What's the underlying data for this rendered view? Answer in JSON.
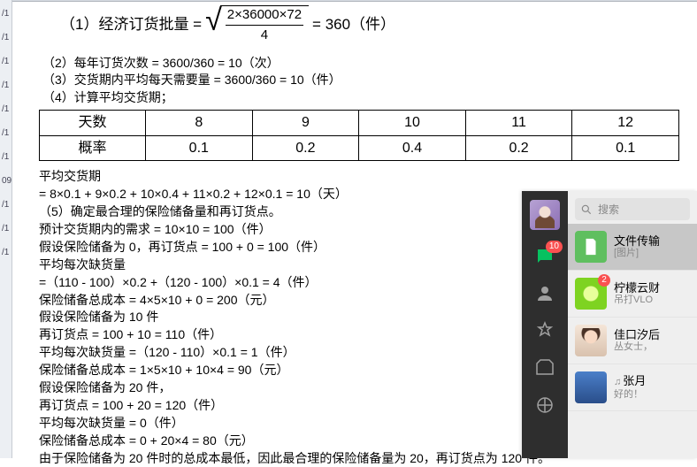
{
  "doc": {
    "f1_label": "（1）经济订货批量 =",
    "f1_num": "2×36000×72",
    "f1_den": "4",
    "f1_result": " = 360（件）",
    "l2": "（2）每年订货次数 = 3600/360 = 10（次）",
    "l3": "（3）交货期内平均每天需要量 = 3600/360 = 10（件）",
    "l4": "（4）计算平均交货期；",
    "table": {
      "row1_label": "天数",
      "row2_label": "概率",
      "c1": "8",
      "c2": "9",
      "c3": "10",
      "c4": "11",
      "c5": "12",
      "p1": "0.1",
      "p2": "0.2",
      "p3": "0.4",
      "p4": "0.2",
      "p5": "0.1"
    },
    "l5": "平均交货期",
    "l6": "= 8×0.1 + 9×0.2 + 10×0.4 + 11×0.2 + 12×0.1 = 10（天）",
    "l7": "（5）确定最合理的保险储备量和再订货点。",
    "l8": "预计交货期内的需求 = 10×10 = 100（件）",
    "l9": "假设保险储备为 0，再订货点 = 100 + 0 = 100（件）",
    "l10": "平均每次缺货量",
    "l11": "=（110 - 100）×0.2 +（120 - 100）×0.1 = 4（件）",
    "l12": "保险储备总成本 = 4×5×10 + 0 = 200（元）",
    "l13": "假设保险储备为 10 件",
    "l14": "再订货点 = 100 + 10 = 110（件）",
    "l15": "平均每次缺货量 =（120 - 110）×0.1 = 1（件）",
    "l16": "保险储备总成本 = 1×5×10 + 10×4 = 90（元）",
    "l17": "假设保险储备为 20 件，",
    "l18": "再订货点 = 100 + 20 = 120（件）",
    "l19": "平均每次缺货量 = 0（件）",
    "l20": "保险储备总成本 = 0 + 20×4 = 80（元）",
    "l21": "由于保险储备为 20 件时的总成本最低，因此最合理的保险储备量为 20，再订货点为 120 件。"
  },
  "wechat": {
    "search_placeholder": "搜索",
    "chat_badge": "10",
    "items": [
      {
        "name": "文件传输",
        "sub": "[图片]"
      },
      {
        "name": "柠檬云财",
        "sub": "吊打VLO",
        "badge": "2"
      },
      {
        "name": "佳口汐后",
        "sub": "丛女士，"
      },
      {
        "name": "张月",
        "sub": "好的！",
        "note": true
      }
    ]
  },
  "leftbar": [
    "/1",
    "/1",
    "/1",
    "/1",
    "/1",
    "/1",
    "/1",
    "09",
    "/1",
    "/1",
    "/1"
  ]
}
